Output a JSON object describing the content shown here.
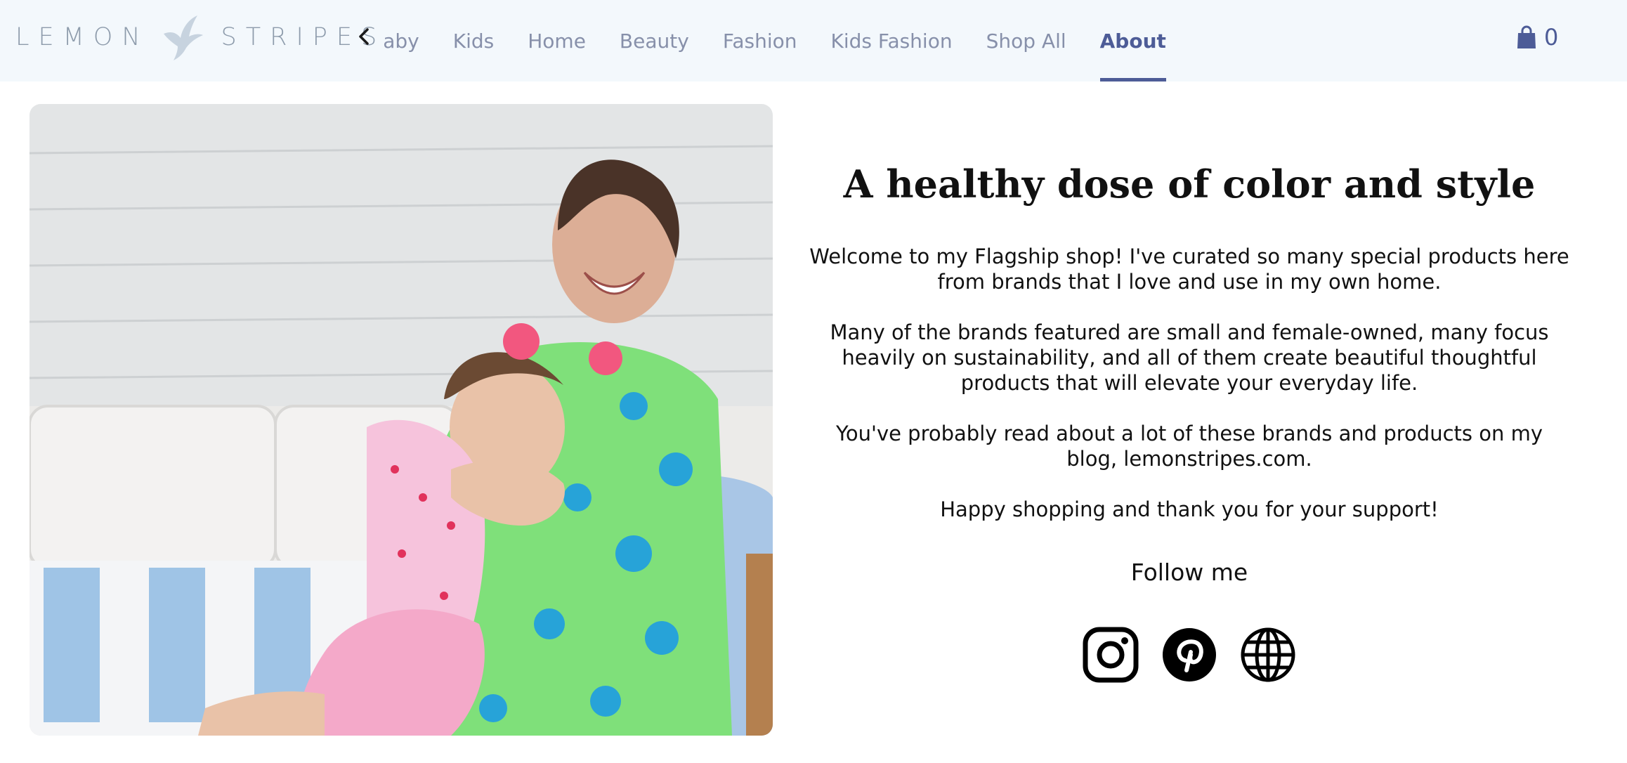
{
  "brand": {
    "word1": "LEMON",
    "word2": "STRIPES"
  },
  "nav": {
    "items": [
      {
        "label": "Baby"
      },
      {
        "label": "Kids"
      },
      {
        "label": "Home"
      },
      {
        "label": "Beauty"
      },
      {
        "label": "Fashion"
      },
      {
        "label": "Kids Fashion"
      },
      {
        "label": "Shop All"
      },
      {
        "label": "About"
      }
    ],
    "active": "About"
  },
  "cart": {
    "count": "0"
  },
  "about": {
    "headline": "A healthy dose of color and style",
    "paragraphs": [
      "Welcome to my Flagship shop! I've curated so many special products here from brands that I love and use in my own home.",
      "Many of the brands featured are small and female-owned, many focus heavily on sustainability, and all of them create beautiful thoughtful products that will elevate your everyday life.",
      "You've probably read about a lot of these brands and products on my blog, lemonstripes.com.",
      "Happy shopping and thank you for your support!"
    ],
    "follow_label": "Follow me",
    "social": [
      "instagram-icon",
      "pinterest-icon",
      "globe-icon"
    ]
  },
  "colors": {
    "accent": "#4d5c97",
    "topbar": "#f3f8fc",
    "nav_text": "#8790aa",
    "logo": "#8d9bab"
  }
}
